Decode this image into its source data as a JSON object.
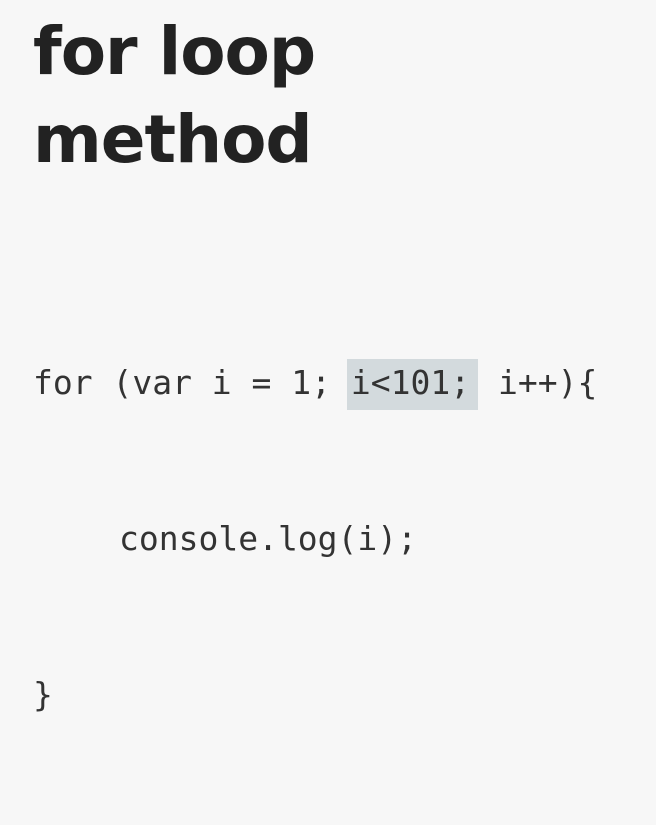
{
  "slide": {
    "title_line1": "for loop",
    "title_line2": "method"
  },
  "code": {
    "line1_before": "for (var i = 1; ",
    "line1_highlight": "i<101;",
    "line1_after": " i++){",
    "line2": "console.log(i);",
    "line3": "}"
  },
  "colors": {
    "background": "#f7f7f7",
    "text": "#222222",
    "highlight": "#d3dadd"
  }
}
